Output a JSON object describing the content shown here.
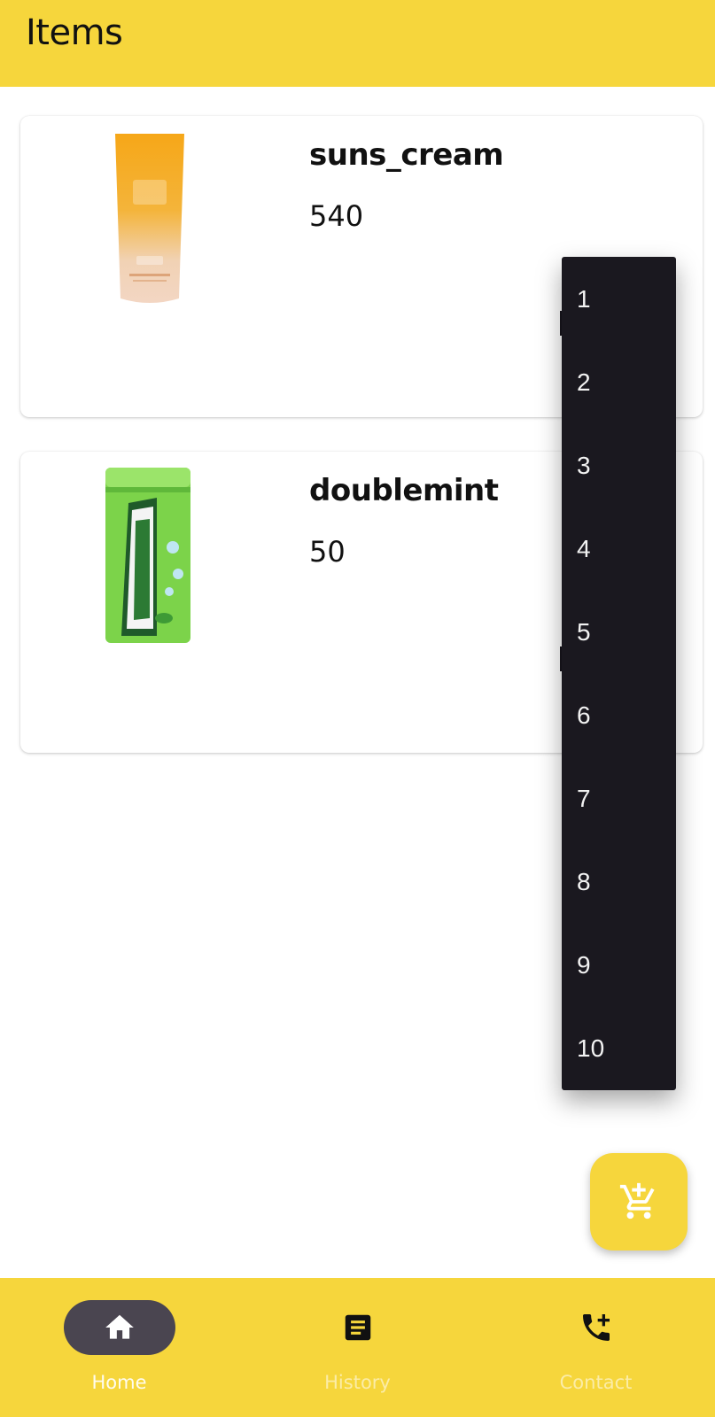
{
  "app_bar": {
    "title": "Items"
  },
  "items": [
    {
      "name": "suns_cream",
      "price": "540",
      "image": "sunscreen-tube-image"
    },
    {
      "name": "doublemint",
      "price": "50",
      "image": "mint-pack-image"
    }
  ],
  "quantity_dropdown": {
    "options": [
      "1",
      "2",
      "3",
      "4",
      "5",
      "6",
      "7",
      "8",
      "9",
      "10"
    ]
  },
  "fab": {
    "icon": "add-to-cart-icon"
  },
  "bottom_nav": {
    "items": [
      {
        "label": "Home",
        "icon": "home-icon",
        "active": true
      },
      {
        "label": "History",
        "icon": "document-icon",
        "active": false
      },
      {
        "label": "Contact",
        "icon": "add-call-icon",
        "active": false
      }
    ]
  },
  "colors": {
    "primary": "#f6d63c",
    "menu_bg": "#1a181f",
    "nav_pill": "#4a4550"
  }
}
